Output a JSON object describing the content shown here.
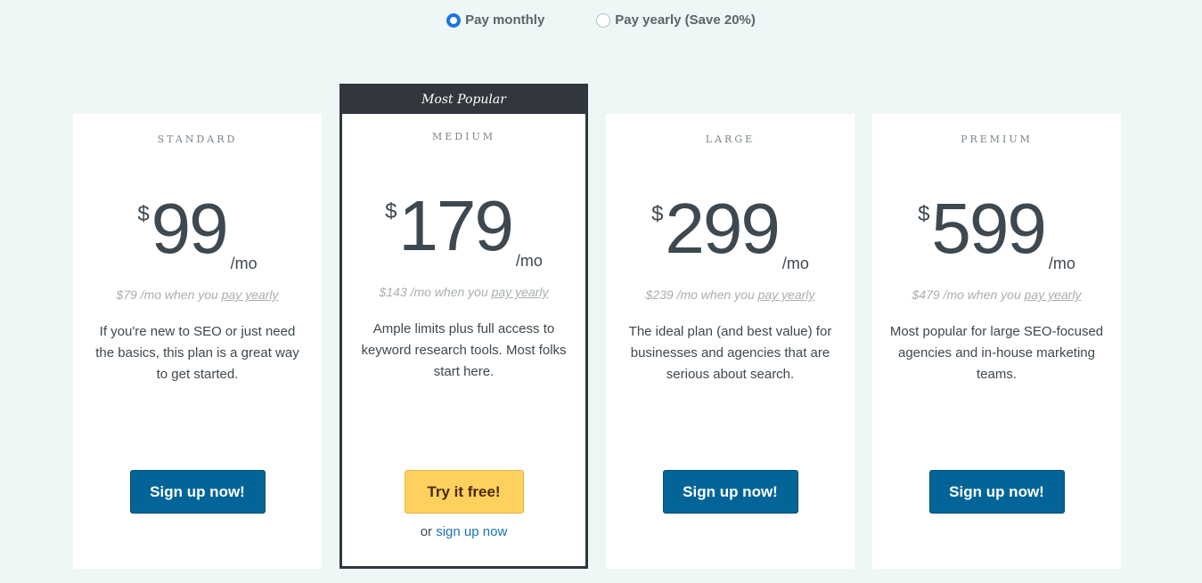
{
  "billing": {
    "options": [
      {
        "label": "Pay monthly",
        "selected": true
      },
      {
        "label": "Pay yearly (Save 20%)",
        "selected": false
      }
    ]
  },
  "plans": [
    {
      "name": "STANDARD",
      "currency": "$",
      "price": "99",
      "period": "/mo",
      "yearly_prefix": "$79 /mo when you ",
      "yearly_link": "pay yearly",
      "description": "If you're new to SEO or just need the basics, this plan is a great way to get started.",
      "cta": "Sign up now!"
    },
    {
      "badge": "Most Popular",
      "name": "MEDIUM",
      "currency": "$",
      "price": "179",
      "period": "/mo",
      "yearly_prefix": "$143 /mo when you ",
      "yearly_link": "pay yearly",
      "description": "Ample limits plus full access to keyword research tools. Most folks start here.",
      "cta": "Try it free!",
      "alt_prefix": "or ",
      "alt_link": "sign up now"
    },
    {
      "name": "LARGE",
      "currency": "$",
      "price": "299",
      "period": "/mo",
      "yearly_prefix": "$239 /mo when you ",
      "yearly_link": "pay yearly",
      "description": "The ideal plan (and best value) for businesses and agencies that are serious about search.",
      "cta": "Sign up now!"
    },
    {
      "name": "PREMIUM",
      "currency": "$",
      "price": "599",
      "period": "/mo",
      "yearly_prefix": "$479 /mo when you ",
      "yearly_link": "pay yearly",
      "description": "Most popular for large SEO-focused agencies and in-house marketing teams.",
      "cta": "Sign up now!"
    }
  ],
  "colors": {
    "accent_blue": "#036597",
    "cta_yellow": "#fed15f",
    "popular_dark": "#32373d",
    "radio_selected": "#1a73e8"
  }
}
